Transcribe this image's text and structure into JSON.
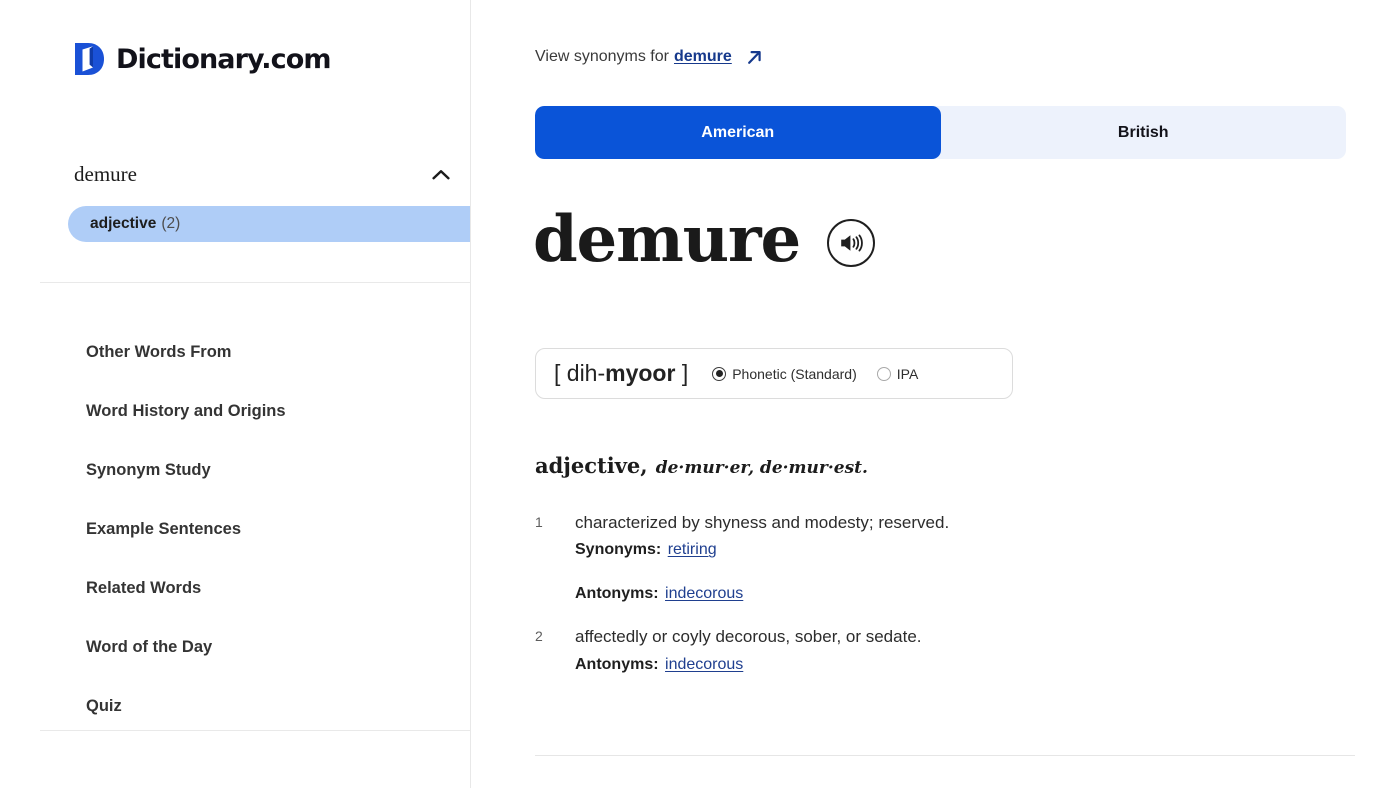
{
  "brand": {
    "name": "Dictionary.com",
    "logo_icon": "dictionary-d-logo-icon",
    "logo_color": "#1a51d6"
  },
  "sidebar": {
    "word": "demure",
    "collapse_icon": "chevron-up-icon",
    "part_of_speech": {
      "label": "adjective",
      "count": "(2)"
    },
    "nav_items": [
      {
        "label": "Other Words From"
      },
      {
        "label": "Word History and Origins"
      },
      {
        "label": "Synonym Study"
      },
      {
        "label": "Example Sentences"
      },
      {
        "label": "Related Words"
      },
      {
        "label": "Word of the Day"
      },
      {
        "label": "Quiz"
      }
    ]
  },
  "main": {
    "synonyms_prompt": {
      "prefix": "View synonyms for",
      "link": "demure",
      "external_icon": "external-link-arrow-icon"
    },
    "tabs": [
      {
        "label": "American",
        "active": true
      },
      {
        "label": "British",
        "active": false
      }
    ],
    "entry": {
      "headword": "demure",
      "audio_icon": "speaker-audio-icon",
      "pronunciation": {
        "open_bracket": "[",
        "syllable_1": "dih-",
        "syllable_2": "myoor",
        "close_bracket": "]",
        "options": [
          {
            "label": "Phonetic (Standard)",
            "selected": true
          },
          {
            "label": "IPA",
            "selected": false
          }
        ]
      },
      "part_of_speech": "adjective,",
      "inflections": "de·mur·er, de·mur·est.",
      "definitions": [
        {
          "number": "1",
          "text": "characterized by shyness and modesty; reserved.",
          "synonyms_label": "Synonyms:",
          "synonyms_link": "retiring",
          "antonyms_label": "Antonyms:",
          "antonyms_link": "indecorous"
        },
        {
          "number": "2",
          "text": "affectedly or coyly decorous, sober, or sedate.",
          "antonyms_label": "Antonyms:",
          "antonyms_link": "indecorous"
        }
      ]
    }
  },
  "colors": {
    "accent_blue": "#0a54d8",
    "tab_track": "#edf2fc",
    "highlight": "#afcdf7",
    "link": "#16398c"
  }
}
